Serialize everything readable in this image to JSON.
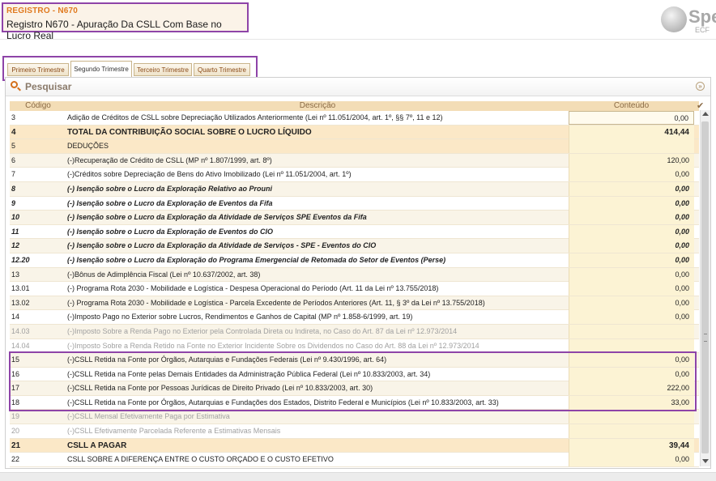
{
  "header": {
    "register_code": "REGISTRO - N670",
    "register_title": "Registro N670 - Apuração Da CSLL Com Base no Lucro Real",
    "logo_text": "Spe",
    "logo_sub": "ECF"
  },
  "tabs": [
    {
      "label": "Primeiro Trimestre",
      "active": false
    },
    {
      "label": "Segundo Trimestre",
      "active": true
    },
    {
      "label": "Terceiro Trimestre",
      "active": false
    },
    {
      "label": "Quarto Trimestre",
      "active": false
    }
  ],
  "search": {
    "label": "Pesquisar"
  },
  "columns": {
    "code": "Código",
    "description": "Descrição",
    "value": "Conteúdo"
  },
  "rows": [
    {
      "code": "3",
      "desc": "Adição de Créditos de CSLL sobre Depreciação Utilizados Anteriormente (Lei nº 11.051/2004, art. 1º, §§ 7º, 11 e 12)",
      "value": "0,00",
      "style": "normal"
    },
    {
      "code": "4",
      "desc": "TOTAL DA CONTRIBUIÇÃO SOCIAL SOBRE O LUCRO LÍQUIDO",
      "value": "414,44",
      "style": "bold"
    },
    {
      "code": "5",
      "desc": "DEDUÇÕES",
      "value": "",
      "style": "section"
    },
    {
      "code": "6",
      "desc": "(-)Recuperação de Crédito de CSLL (MP nº 1.807/1999, art. 8º)",
      "value": "120,00",
      "style": "normal"
    },
    {
      "code": "7",
      "desc": "(-)Créditos sobre Depreciação de Bens do Ativo Imobilizado (Lei nº 11.051/2004, art. 1º)",
      "value": "0,00",
      "style": "normal"
    },
    {
      "code": "8",
      "desc": "(-) Isenção sobre o Lucro da Exploração Relativo ao Prouni",
      "value": "0,00",
      "style": "bi"
    },
    {
      "code": "9",
      "desc": "(-) Isenção sobre o Lucro da Exploração de Eventos da Fifa",
      "value": "0,00",
      "style": "bi"
    },
    {
      "code": "10",
      "desc": "(-) Isenção sobre o Lucro da Exploração da Atividade de Serviços SPE Eventos da Fifa",
      "value": "0,00",
      "style": "bi"
    },
    {
      "code": "11",
      "desc": "(-) Isenção sobre o Lucro da Exploração de Eventos do CIO",
      "value": "0,00",
      "style": "bi"
    },
    {
      "code": "12",
      "desc": "(-) Isenção sobre o Lucro da Exploração da Atividade de Serviços - SPE - Eventos do CIO",
      "value": "0,00",
      "style": "bi"
    },
    {
      "code": "12.20",
      "desc": "(-) Isenção sobre o Lucro da Exploração do Programa Emergencial de Retomada do Setor de Eventos (Perse)",
      "value": "0,00",
      "style": "bi"
    },
    {
      "code": "13",
      "desc": "(-)Bônus de Adimplência Fiscal (Lei nº 10.637/2002, art. 38)",
      "value": "0,00",
      "style": "normal"
    },
    {
      "code": "13.01",
      "desc": "(-) Programa Rota 2030 - Mobilidade e Logística - Despesa Operacional do Período (Art. 11 da Lei nº 13.755/2018)",
      "value": "0,00",
      "style": "normal"
    },
    {
      "code": "13.02",
      "desc": "(-) Programa Rota 2030 - Mobilidade e Logística - Parcela Excedente de Períodos Anteriores (Art. 11, § 3º da Lei nº 13.755/2018)",
      "value": "0,00",
      "style": "normal"
    },
    {
      "code": "14",
      "desc": "(-)Imposto Pago no Exterior sobre Lucros, Rendimentos e Ganhos de Capital (MP nº 1.858-6/1999, art. 19)",
      "value": "0,00",
      "style": "normal"
    },
    {
      "code": "14.03",
      "desc": "(-)Imposto Sobre a Renda Pago no Exterior pela Controlada Direta ou Indireta, no Caso do Art. 87 da Lei nº 12.973/2014",
      "value": "",
      "style": "disabled"
    },
    {
      "code": "14.04",
      "desc": "(-)Imposto Sobre a Renda Retido na Fonte no Exterior Incidente Sobre os Dividendos no Caso do Art. 88 da Lei nº 12.973/2014",
      "value": "",
      "style": "disabled"
    },
    {
      "code": "15",
      "desc": "(-)CSLL Retida na Fonte por Órgãos, Autarquias e Fundações Federais (Lei nº 9.430/1996, art. 64)",
      "value": "0,00",
      "style": "normal"
    },
    {
      "code": "16",
      "desc": "(-)CSLL Retida na Fonte pelas Demais Entidades da Administração Pública Federal (Lei nº 10.833/2003, art. 34)",
      "value": "0,00",
      "style": "normal"
    },
    {
      "code": "17",
      "desc": "(-)CSLL Retida na Fonte por Pessoas Jurídicas de Direito Privado (Lei nº 10.833/2003, art. 30)",
      "value": "222,00",
      "style": "normal"
    },
    {
      "code": "18",
      "desc": "(-)CSLL Retida na Fonte por Órgãos, Autarquias e Fundações dos Estados, Distrito Federal e Municípios (Lei nº 10.833/2003, art. 33)",
      "value": "33,00",
      "style": "normal"
    },
    {
      "code": "19",
      "desc": "(-)CSLL Mensal Efetivamente Paga por Estimativa",
      "value": "",
      "style": "disabled"
    },
    {
      "code": "20",
      "desc": "(-)CSLL Efetivamente Parcelada Referente a Estimativas Mensais",
      "value": "",
      "style": "disabled"
    },
    {
      "code": "21",
      "desc": "CSLL A PAGAR",
      "value": "39,44",
      "style": "bold"
    },
    {
      "code": "22",
      "desc": "CSLL SOBRE A DIFERENÇA ENTRE O CUSTO ORÇADO E O CUSTO EFETIVO",
      "value": "0,00",
      "style": "normal"
    }
  ]
}
